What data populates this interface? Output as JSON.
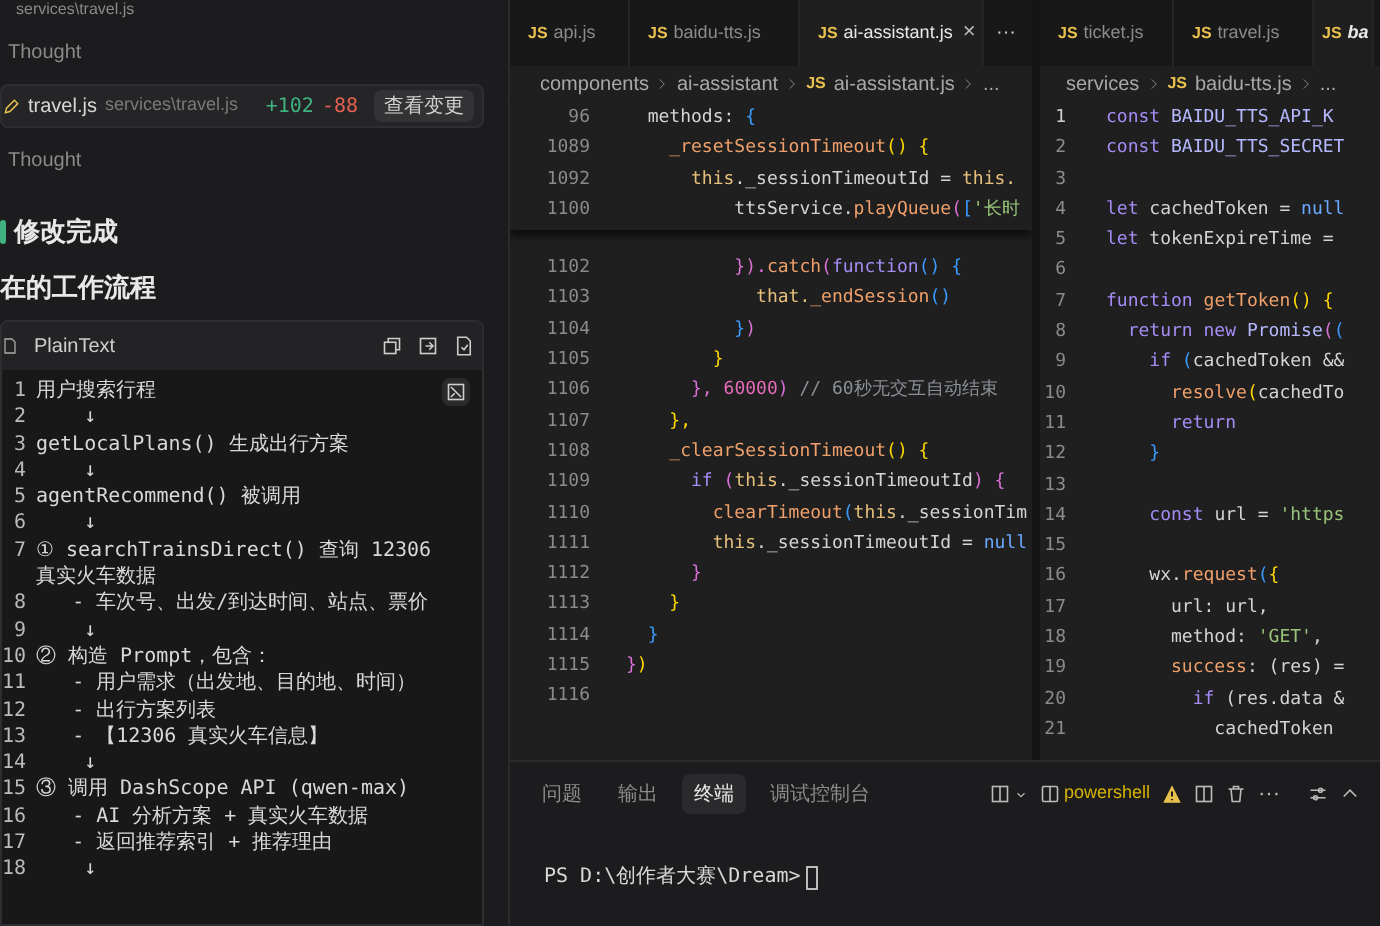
{
  "chat": {
    "top_path": "services\\travel.js",
    "thought_1": "Thought",
    "file_change": {
      "file": "travel.js",
      "path": "services\\travel.js",
      "added": "+102",
      "removed": "-88",
      "button": "查看变更"
    },
    "thought_2": "Thought",
    "heading_1": "修改完成",
    "heading_2": "在的工作流程",
    "code_block": {
      "language": "PlainText",
      "lines": [
        {
          "number": "1",
          "text": "用户搜索行程"
        },
        {
          "number": "2",
          "text": "    ↓"
        },
        {
          "number": "3",
          "text": "getLocalPlans() 生成出行方案"
        },
        {
          "number": "4",
          "text": "    ↓"
        },
        {
          "number": "5",
          "text": "agentRecommend() 被调用"
        },
        {
          "number": "6",
          "text": "    ↓"
        },
        {
          "number": "7",
          "text": "① searchTrainsDirect() 查询 12306 真实火车数据"
        },
        {
          "number": "8",
          "text": "   - 车次号、出发/到达时间、站点、票价"
        },
        {
          "number": "9",
          "text": "    ↓"
        },
        {
          "number": "10",
          "text": "② 构造 Prompt，包含："
        },
        {
          "number": "11",
          "text": "   - 用户需求（出发地、目的地、时间）"
        },
        {
          "number": "12",
          "text": "   - 出行方案列表"
        },
        {
          "number": "13",
          "text": "   - 【12306 真实火车信息】"
        },
        {
          "number": "14",
          "text": "    ↓"
        },
        {
          "number": "15",
          "text": "③ 调用 DashScope API (qwen-max)"
        },
        {
          "number": "16",
          "text": "   - AI 分析方案 + 真实火车数据"
        },
        {
          "number": "17",
          "text": "   - 返回推荐索引 + 推荐理由"
        },
        {
          "number": "18",
          "text": "    ↓"
        }
      ]
    }
  },
  "editors": [
    {
      "tabs": [
        {
          "badge": "JS",
          "label": "api.js",
          "selected": false,
          "preview": false
        },
        {
          "badge": "JS",
          "label": "baidu-tts.js",
          "selected": false,
          "preview": false
        },
        {
          "badge": "JS",
          "label": "ai-assistant.js",
          "selected": true,
          "preview": false,
          "close": "×"
        }
      ],
      "more": "···",
      "breadcrumb": [
        {
          "text": "components"
        },
        {
          "text": "ai-assistant"
        },
        {
          "badge": "JS",
          "text": "ai-assistant.js"
        },
        {
          "text": "..."
        }
      ],
      "sticky_lines": [
        {
          "number": "96",
          "tokens": [
            {
              "text": "  methods: ",
              "kind": "id"
            },
            {
              "text": "{",
              "kind": "b3"
            }
          ]
        },
        {
          "number": "1089",
          "tokens": [
            {
              "text": "    _resetSessionTimeout",
              "kind": "fn"
            },
            {
              "text": "() {",
              "kind": "b1"
            }
          ]
        },
        {
          "number": "1092",
          "tokens": [
            {
              "text": "      this",
              "kind": "th"
            },
            {
              "text": "._sessionTimeoutId = ",
              "kind": "id"
            },
            {
              "text": "this.",
              "kind": "th"
            }
          ]
        },
        {
          "number": "1100",
          "tokens": [
            {
              "text": "          ttsService.",
              "kind": "id"
            },
            {
              "text": "playQueue",
              "kind": "fn"
            },
            {
              "text": "(",
              "kind": "b2"
            },
            {
              "text": "[",
              "kind": "b3"
            },
            {
              "text": "'长时",
              "kind": "str"
            }
          ]
        }
      ],
      "lines": [
        {
          "number": "1102",
          "tokens": [
            {
              "text": "          }).",
              "kind": "b2"
            },
            {
              "text": "catch",
              "kind": "fn"
            },
            {
              "text": "(",
              "kind": "b2"
            },
            {
              "text": "function",
              "kind": "kw"
            },
            {
              "text": "() {",
              "kind": "b3"
            }
          ]
        },
        {
          "number": "1103",
          "tokens": [
            {
              "text": "            that.",
              "kind": "th"
            },
            {
              "text": "_endSession",
              "kind": "fn"
            },
            {
              "text": "()",
              "kind": "b3"
            }
          ]
        },
        {
          "number": "1104",
          "tokens": [
            {
              "text": "          }",
              "kind": "b3"
            },
            {
              "text": ")",
              "kind": "b2"
            }
          ]
        },
        {
          "number": "1105",
          "tokens": [
            {
              "text": "        }",
              "kind": "b1"
            }
          ]
        },
        {
          "number": "1106",
          "tokens": [
            {
              "text": "      },",
              "kind": "b2"
            },
            {
              "text": " 60000",
              "kind": "num"
            },
            {
              "text": ")",
              "kind": "b2"
            },
            {
              "text": " // 60秒无交互自动结束",
              "kind": "cm"
            }
          ]
        },
        {
          "number": "1107",
          "tokens": [
            {
              "text": "    },",
              "kind": "b1"
            }
          ]
        },
        {
          "number": "1108",
          "tokens": [
            {
              "text": "    _clearSessionTimeout",
              "kind": "fn"
            },
            {
              "text": "() {",
              "kind": "b1"
            }
          ]
        },
        {
          "number": "1109",
          "tokens": [
            {
              "text": "      if",
              "kind": "kw"
            },
            {
              "text": " (",
              "kind": "b2"
            },
            {
              "text": "this",
              "kind": "th"
            },
            {
              "text": "._sessionTimeoutId",
              "kind": "id"
            },
            {
              "text": ") {",
              "kind": "b2"
            }
          ]
        },
        {
          "number": "1110",
          "tokens": [
            {
              "text": "        clearTimeout",
              "kind": "fn"
            },
            {
              "text": "(",
              "kind": "b3"
            },
            {
              "text": "this",
              "kind": "th"
            },
            {
              "text": "._sessionTim",
              "kind": "id"
            }
          ]
        },
        {
          "number": "1111",
          "tokens": [
            {
              "text": "        this",
              "kind": "th"
            },
            {
              "text": "._sessionTimeoutId = ",
              "kind": "id"
            },
            {
              "text": "null",
              "kind": "nl"
            }
          ]
        },
        {
          "number": "1112",
          "tokens": [
            {
              "text": "      }",
              "kind": "b2"
            }
          ]
        },
        {
          "number": "1113",
          "tokens": [
            {
              "text": "    }",
              "kind": "b1"
            }
          ]
        },
        {
          "number": "1114",
          "tokens": [
            {
              "text": "  }",
              "kind": "b3"
            }
          ]
        },
        {
          "number": "1115",
          "tokens": [
            {
              "text": "}",
              "kind": "b2"
            },
            {
              "text": ")",
              "kind": "b1"
            }
          ]
        },
        {
          "number": "1116"
        }
      ]
    },
    {
      "tabs": [
        {
          "badge": "JS",
          "label": "ticket.js",
          "selected": false,
          "preview": false
        },
        {
          "badge": "JS",
          "label": "travel.js",
          "selected": false,
          "preview": false
        },
        {
          "badge": "JS",
          "label": "ba",
          "selected": true,
          "preview": true
        }
      ],
      "breadcrumb": [
        {
          "text": "services"
        },
        {
          "badge": "JS",
          "text": "baidu-tts.js"
        },
        {
          "text": "..."
        }
      ],
      "lines": [
        {
          "number": "1",
          "tokens": [
            {
              "text": "const",
              "kind": "kw"
            },
            {
              "text": " BAIDU_TTS_API_K",
              "kind": "cn"
            }
          ]
        },
        {
          "number": "2",
          "tokens": [
            {
              "text": "const",
              "kind": "kw"
            },
            {
              "text": " BAIDU_TTS_SECRET",
              "kind": "cn"
            }
          ]
        },
        {
          "number": "3"
        },
        {
          "number": "4",
          "tokens": [
            {
              "text": "let",
              "kind": "kw"
            },
            {
              "text": " cachedToken = ",
              "kind": "id"
            },
            {
              "text": "null",
              "kind": "nl"
            }
          ]
        },
        {
          "number": "5",
          "tokens": [
            {
              "text": "let",
              "kind": "kw"
            },
            {
              "text": " tokenExpireTime =",
              "kind": "id"
            }
          ]
        },
        {
          "number": "6"
        },
        {
          "number": "7",
          "tokens": [
            {
              "text": "function",
              "kind": "kw"
            },
            {
              "text": " getToken",
              "kind": "fn"
            },
            {
              "text": "() {",
              "kind": "b1"
            }
          ]
        },
        {
          "number": "8",
          "tokens": [
            {
              "text": "  return new",
              "kind": "kw"
            },
            {
              "text": " Promise",
              "kind": "cn"
            },
            {
              "text": "(",
              "kind": "b2"
            },
            {
              "text": "(",
              "kind": "b3"
            }
          ]
        },
        {
          "number": "9",
          "tokens": [
            {
              "text": "    if",
              "kind": "kw"
            },
            {
              "text": " (",
              "kind": "b3"
            },
            {
              "text": "cachedToken &&",
              "kind": "id"
            }
          ]
        },
        {
          "number": "10",
          "tokens": [
            {
              "text": "      resolve",
              "kind": "fn"
            },
            {
              "text": "(",
              "kind": "b1"
            },
            {
              "text": "cachedTo",
              "kind": "id"
            }
          ]
        },
        {
          "number": "11",
          "tokens": [
            {
              "text": "      return",
              "kind": "kw"
            }
          ]
        },
        {
          "number": "12",
          "tokens": [
            {
              "text": "    }",
              "kind": "b3"
            }
          ]
        },
        {
          "number": "13"
        },
        {
          "number": "14",
          "tokens": [
            {
              "text": "    const",
              "kind": "kw"
            },
            {
              "text": " url = ",
              "kind": "id"
            },
            {
              "text": "'https",
              "kind": "str"
            }
          ]
        },
        {
          "number": "15"
        },
        {
          "number": "16",
          "tokens": [
            {
              "text": "    wx.",
              "kind": "id"
            },
            {
              "text": "request",
              "kind": "fn"
            },
            {
              "text": "(",
              "kind": "b3"
            },
            {
              "text": "{",
              "kind": "b1"
            }
          ]
        },
        {
          "number": "17",
          "tokens": [
            {
              "text": "      url: url,",
              "kind": "id"
            }
          ]
        },
        {
          "number": "18",
          "tokens": [
            {
              "text": "      method: ",
              "kind": "id"
            },
            {
              "text": "'GET'",
              "kind": "str"
            },
            {
              "text": ",",
              "kind": "id"
            }
          ]
        },
        {
          "number": "19",
          "tokens": [
            {
              "text": "      success",
              "kind": "fn"
            },
            {
              "text": ": (res) =",
              "kind": "id"
            }
          ]
        },
        {
          "number": "20",
          "tokens": [
            {
              "text": "        if",
              "kind": "kw"
            },
            {
              "text": " (res.data &",
              "kind": "id"
            }
          ]
        },
        {
          "number": "21",
          "tokens": [
            {
              "text": "          cachedToken",
              "kind": "id"
            }
          ]
        }
      ]
    }
  ],
  "terminal": {
    "tabs": [
      {
        "label": "问题",
        "selected": false
      },
      {
        "label": "输出",
        "selected": false
      },
      {
        "label": "终端",
        "selected": true
      },
      {
        "label": "调试控制台",
        "selected": false
      }
    ],
    "shell": "powershell",
    "more": "···",
    "prompt": "PS D:\\创作者大赛\\Dream>"
  }
}
